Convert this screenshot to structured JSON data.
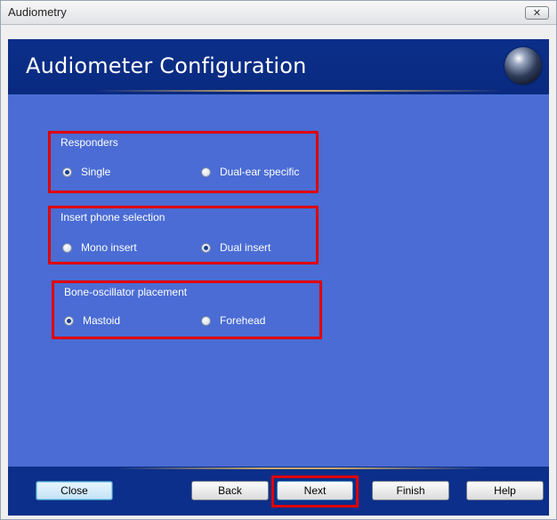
{
  "window": {
    "title": "Audiometry",
    "close_glyph": "✕"
  },
  "header": {
    "title": "Audiometer Configuration",
    "logo_icon": "sphere-icon"
  },
  "groups": [
    {
      "label": "Responders",
      "options": [
        {
          "label": "Single",
          "selected": true
        },
        {
          "label": "Dual-ear specific",
          "selected": false
        }
      ]
    },
    {
      "label": "Insert phone selection",
      "options": [
        {
          "label": "Mono insert",
          "selected": false
        },
        {
          "label": "Dual insert",
          "selected": true
        }
      ]
    },
    {
      "label": "Bone-oscillator placement",
      "options": [
        {
          "label": "Mastoid",
          "selected": true
        },
        {
          "label": "Forehead",
          "selected": false
        }
      ]
    }
  ],
  "buttons": {
    "close": "Close",
    "back": "Back",
    "next": "Next",
    "finish": "Finish",
    "help": "Help"
  },
  "colors": {
    "header_blue": "#0b2f8a",
    "panel_blue": "#4a6cd4",
    "highlight_red": "#e00000"
  }
}
